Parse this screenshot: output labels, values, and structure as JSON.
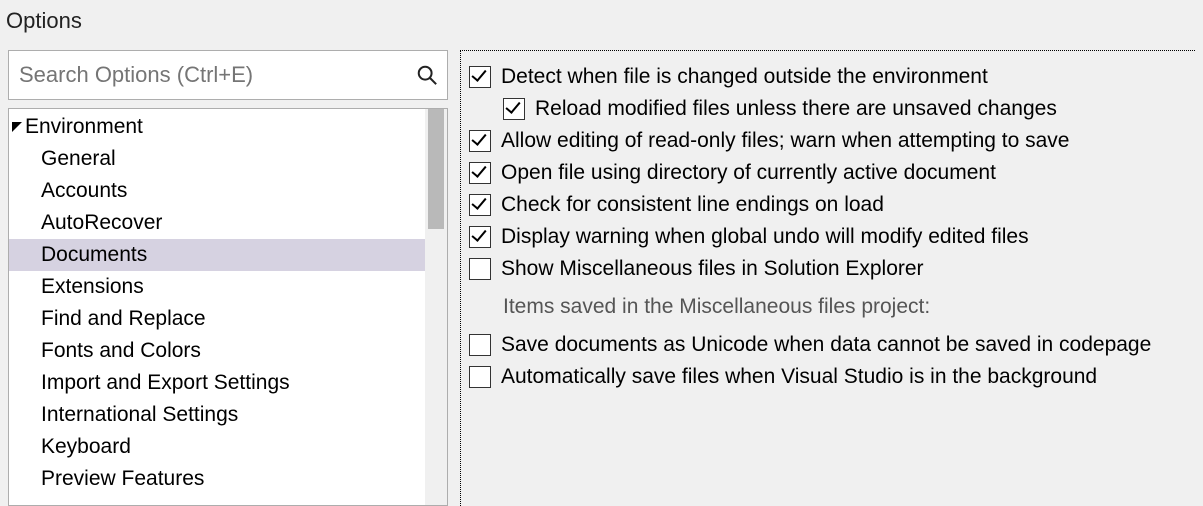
{
  "title": "Options",
  "search": {
    "placeholder": "Search Options (Ctrl+E)",
    "value": ""
  },
  "tree": {
    "parent": {
      "label": "Environment",
      "expanded": true
    },
    "items": [
      {
        "label": "General",
        "selected": false
      },
      {
        "label": "Accounts",
        "selected": false
      },
      {
        "label": "AutoRecover",
        "selected": false
      },
      {
        "label": "Documents",
        "selected": true
      },
      {
        "label": "Extensions",
        "selected": false
      },
      {
        "label": "Find and Replace",
        "selected": false
      },
      {
        "label": "Fonts and Colors",
        "selected": false
      },
      {
        "label": "Import and Export Settings",
        "selected": false
      },
      {
        "label": "International Settings",
        "selected": false
      },
      {
        "label": "Keyboard",
        "selected": false
      },
      {
        "label": "Preview Features",
        "selected": false
      }
    ]
  },
  "options": {
    "detect_changed": {
      "label": "Detect when file is changed outside the environment",
      "checked": true
    },
    "reload_modified": {
      "label": "Reload modified files unless there are unsaved changes",
      "checked": true
    },
    "allow_readonly": {
      "label": "Allow editing of read-only files; warn when attempting to save",
      "checked": true
    },
    "open_using_dir": {
      "label": "Open file using directory of currently active document",
      "checked": true
    },
    "consistent_line_endings": {
      "label": "Check for consistent line endings on load",
      "checked": true
    },
    "global_undo_warn": {
      "label": "Display warning when global undo will modify edited files",
      "checked": true
    },
    "show_misc": {
      "label": "Show Miscellaneous files in Solution Explorer",
      "checked": false
    },
    "misc_sublabel": "Items saved in the Miscellaneous files project:",
    "save_unicode": {
      "label": "Save documents as Unicode when data cannot be saved in codepage",
      "checked": false
    },
    "auto_save_bg": {
      "label": "Automatically save files when Visual Studio is in the background",
      "checked": false
    }
  }
}
